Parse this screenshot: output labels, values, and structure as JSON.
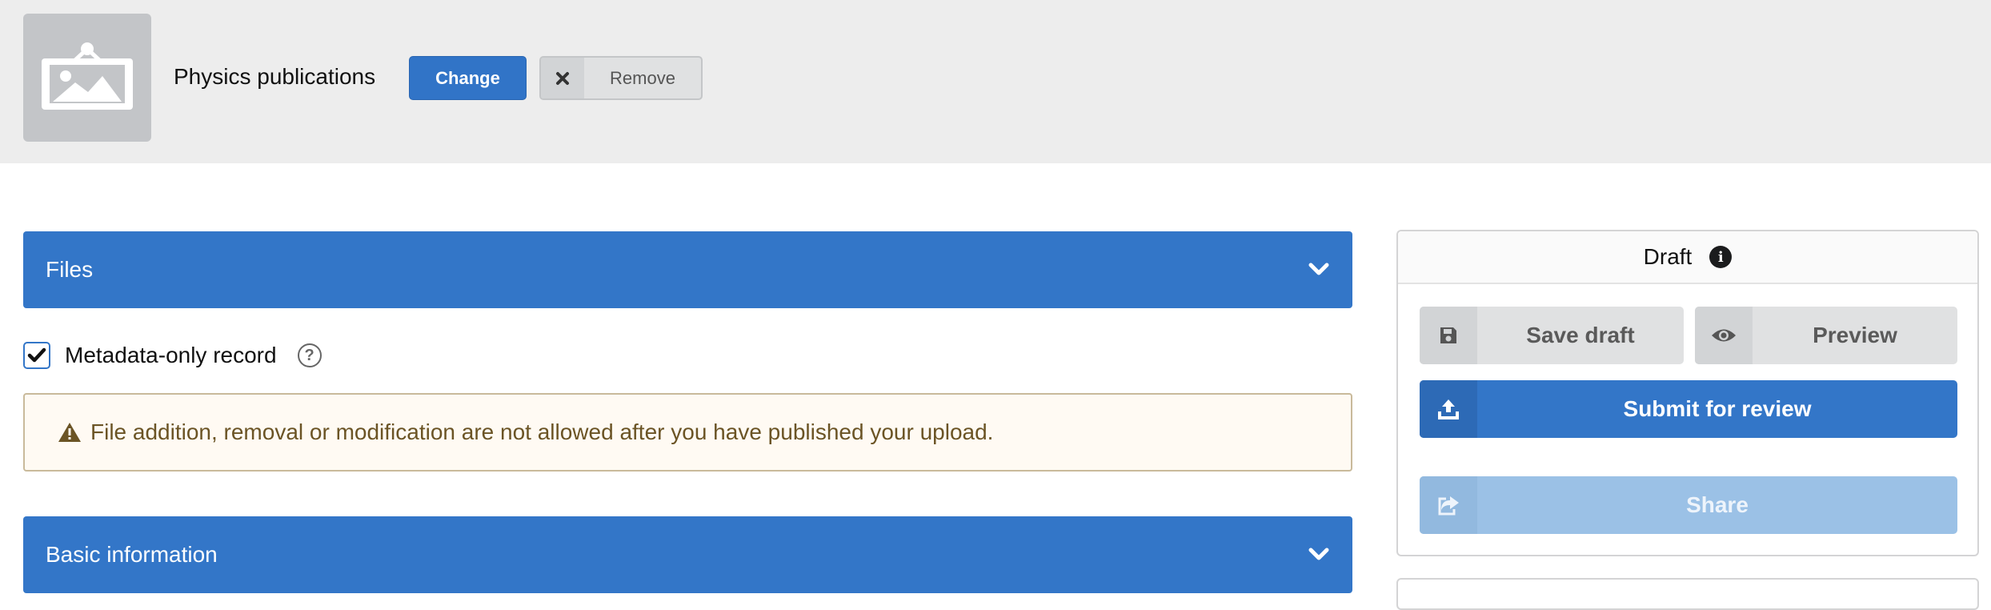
{
  "community": {
    "logo_icon": "image-placeholder-icon",
    "name": "Physics publications",
    "change_label": "Change",
    "remove_label": "Remove",
    "remove_icon": "close-icon"
  },
  "sections": {
    "files_title": "Files",
    "basic_info_title": "Basic information"
  },
  "files": {
    "metadata_only_label": "Metadata-only record",
    "metadata_only_checked": true,
    "help_symbol": "?",
    "warning_text": "File addition, removal or modification are not allowed after you have published your upload."
  },
  "sidebar": {
    "status": "Draft",
    "info_symbol": "i",
    "save_label": "Save draft",
    "preview_label": "Preview",
    "submit_label": "Submit for review",
    "share_label": "Share"
  },
  "colors": {
    "primary": "#3376c8",
    "share_disabled": "#9bc1e6",
    "warning_text": "#6b5425",
    "warning_bg": "#fffaf3"
  }
}
